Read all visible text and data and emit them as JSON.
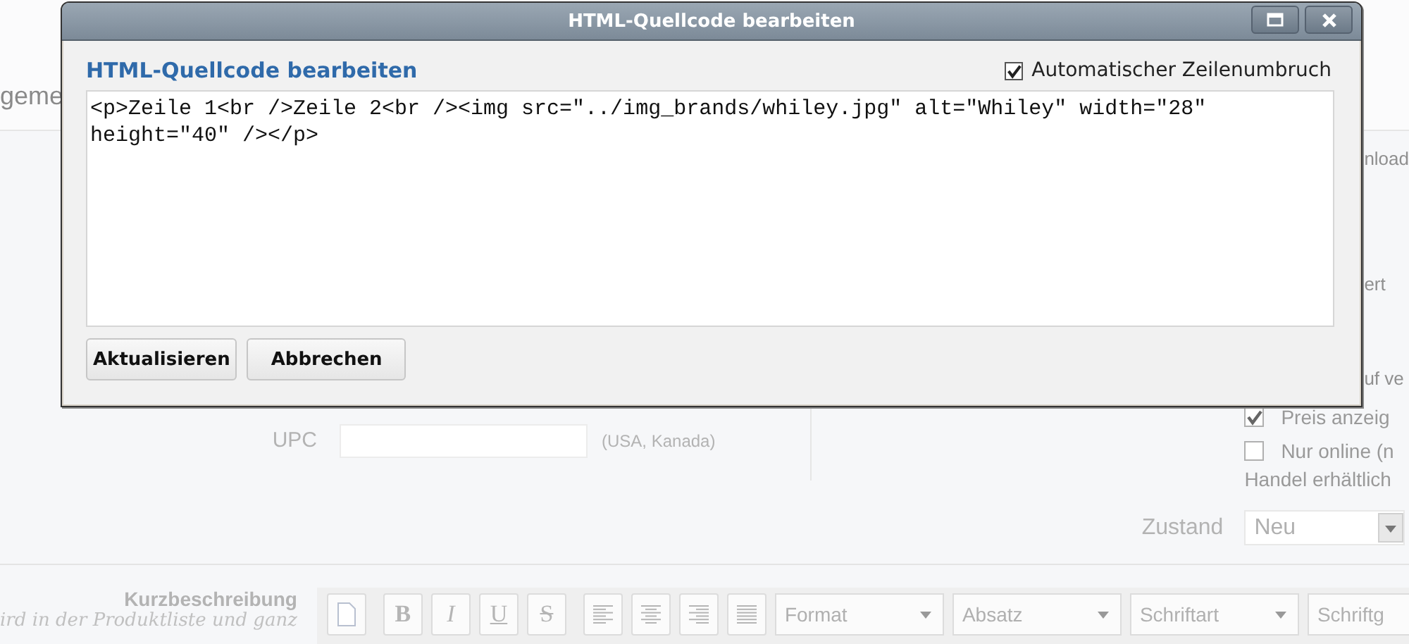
{
  "dialog": {
    "title": "HTML-Quellcode bearbeiten",
    "heading": "HTML-Quellcode bearbeiten",
    "line_wrap": {
      "label": "Automatischer Zeilenumbruch",
      "checked": true
    },
    "code": "<p>Zeile 1<br />Zeile 2<br /><img src=\"../img_brands/whiley.jpg\" alt=\"Whiley\" width=\"28\" height=\"40\" /></p>",
    "buttons": [
      "Aktualisieren",
      "Abbrechen"
    ]
  },
  "background": {
    "section_title": "geme",
    "right_fragments": [
      "nload",
      "ert",
      "uf ve"
    ],
    "upc": {
      "label": "UPC",
      "hint": "(USA, Kanada)"
    },
    "options": [
      {
        "label": "Preis anzeig",
        "checked": true
      },
      {
        "label": "Nur online (n",
        "checked": false
      }
    ],
    "options_note": "Handel erhältlich",
    "condition": {
      "label": "Zustand",
      "value": "Neu"
    },
    "short_description": {
      "label": "Kurzbeschreibung",
      "hint": "ird in der Produktliste und ganz"
    },
    "toolbar": {
      "buttons": [
        {
          "kind": "new-document"
        },
        {
          "kind": "bold",
          "text": "B"
        },
        {
          "kind": "italic",
          "text": "I"
        },
        {
          "kind": "underline",
          "text": "U"
        },
        {
          "kind": "strike",
          "text": "S"
        },
        {
          "kind": "align-left"
        },
        {
          "kind": "align-center"
        },
        {
          "kind": "align-right"
        },
        {
          "kind": "justify"
        }
      ],
      "dropdowns": [
        "Format",
        "Absatz",
        "Schriftart",
        "Schriftg"
      ]
    }
  }
}
